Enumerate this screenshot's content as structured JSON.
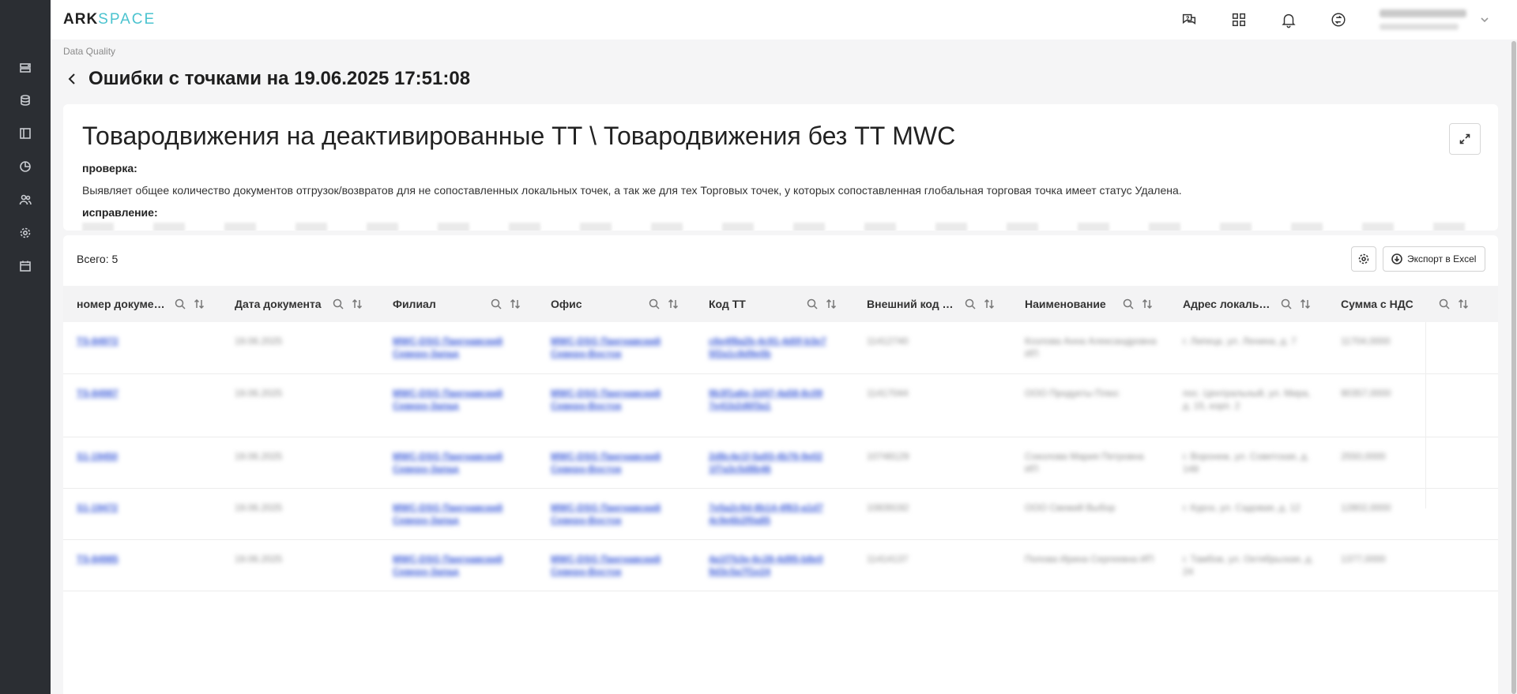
{
  "app": {
    "logo_a": "ARK",
    "logo_b": "SPACE"
  },
  "sidebar": {
    "icons": [
      "list-icon",
      "database-icon",
      "panel-icon",
      "pie-chart-icon",
      "users-icon",
      "gear-icon",
      "calendar-icon"
    ]
  },
  "topbar": {
    "icons": [
      "help-chat-icon",
      "apps-grid-icon",
      "bell-icon",
      "sync-icon"
    ],
    "user_name": "(blurred)",
    "user_role": "(blurred)"
  },
  "breadcrumb": "Data Quality",
  "page_title": "Ошибки с точками на 19.06.2025 17:51:08",
  "description": {
    "title": "Товародвижения на деактивированные ТТ \\ Товародвижения без ТТ MWC",
    "check_label": "проверка:",
    "check_text": "Выявляет общее количество документов отгрузок/возвратов для не сопоставленных локальных точек, а так же для тех Торговых точек, у которых сопоставленная глобальная торговая точка имеет статус Удалена.",
    "fix_label": "исправление:"
  },
  "table": {
    "total_label": "Всего: 5",
    "export_label": "Экспорт в Excel",
    "columns": [
      "номер документа",
      "Дата документа",
      "Филиал",
      "Офис",
      "Код ТТ",
      "Внешний код ТТ",
      "Наименование",
      "Адрес локальной ТТ",
      "Сумма с НДС"
    ],
    "rows": [
      [
        "TS-84972",
        "19.06.2025",
        "MWC-DSG Пангнавский Северо-Запад",
        "MWC-DSG Пангнавский Северо-Восток",
        "c6e4f8a2b-4c91-4d0f-b3e7 5f2a1c8d9e0b",
        "11412740",
        "Козлова Анна Александровна ИП",
        "г. Липецк, ул. Ленина, д. 7",
        "11704,0000"
      ],
      [
        "TS-84987",
        "19.06.2025",
        "MWC-DSG Пангнавский Северо-Запад",
        "MWC-DSG Пангнавский Северо-Восток",
        "9b3f1a6e-2d47-4a58-8c09 7e41b2d6f3a1",
        "11417044",
        "ООО Продукты Плюс",
        "пос. Центральный, ул. Мира, д. 15, корп. 2",
        "90357,0000"
      ],
      [
        "S1-19450",
        "19.06.2025",
        "MWC-DSG Пангнавский Северо-Запад",
        "MWC-DSG Пангнавский Северо-Восток",
        "2d8c4e1f-5a93-4b76-9e02 1f7a3c5d8b46",
        "10748129",
        "Соколова Мария Петровна ИП",
        "г. Воронеж, ул. Советская, д. 148",
        "2550,0000"
      ],
      [
        "S1-19472",
        "19.06.2025",
        "MWC-DSG Пангнавский Северо-Запад",
        "MWC-DSG Пангнавский Северо-Восток",
        "7e5a2c9d-8b14-4f63-a1d7 4c9e6b2f0a85",
        "10839192",
        "ООО Свежий Выбор",
        "г. Курск, ул. Садовая, д. 12",
        "12802,0000"
      ],
      [
        "TS-84985",
        "19.06.2025",
        "MWC-DSG Пангнавский Северо-Запад",
        "MWC-DSG Пангнавский Северо-Восток",
        "4a1f7b3e-6c28-4d95-b8e0 9d3c5a7f1e24",
        "11414137",
        "Попова Ирина Сергеевна ИП",
        "г. Тамбов, ул. Октябрьская, д. 24",
        "1377,0000"
      ]
    ]
  }
}
